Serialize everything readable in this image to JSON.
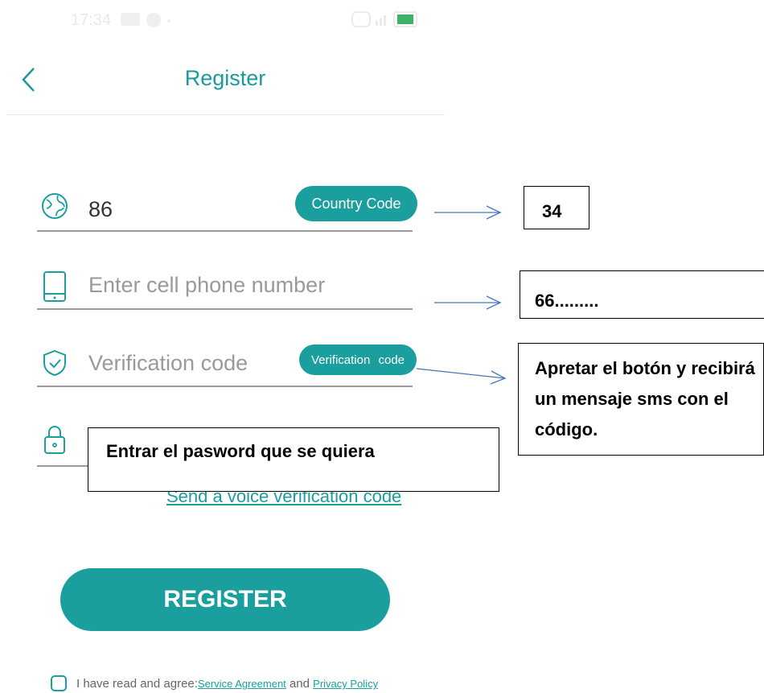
{
  "status_bar": {
    "time": "17:34"
  },
  "header": {
    "title": "Register"
  },
  "form": {
    "country": {
      "value": "86",
      "button_label": "Country Code"
    },
    "phone": {
      "placeholder": "Enter cell phone number"
    },
    "verification": {
      "placeholder": "Verification code",
      "button_label": "Verification code"
    },
    "voice_link": "Send a voice verification code",
    "register_label": "REGISTER",
    "agreement": {
      "prefix": "I have read and agree:",
      "service_link": "Service Agreement",
      "conjunction": " and ",
      "privacy_link": "Privacy Policy"
    }
  },
  "annotations": {
    "country_note": "34",
    "phone_note": "66.........",
    "verification_note": "Apretar el botón y recibirá un mensaje sms con el código.",
    "password_note": "Entrar el pasword que se quiera"
  },
  "colors": {
    "accent": "#1a9e9e",
    "title": "#1a9a9a",
    "battery": "#1fa44e"
  },
  "icons": [
    "back-chevron-icon",
    "globe-icon",
    "phone-icon",
    "shield-check-icon",
    "lock-icon"
  ]
}
